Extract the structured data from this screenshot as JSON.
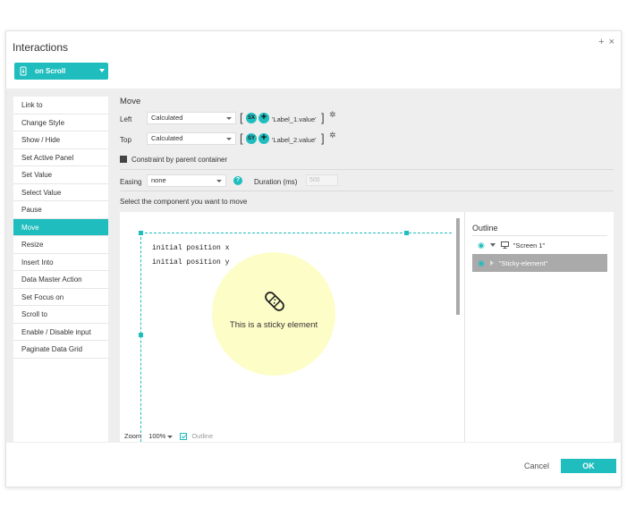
{
  "dialog": {
    "title": "Interactions",
    "add_label": "+",
    "close_label": "×",
    "trigger": {
      "label": "on Scroll",
      "icon": "scroll-icon"
    }
  },
  "actions": [
    "Link to",
    "Change Style",
    "Show / Hide",
    "Set Active Panel",
    "Set Value",
    "Select Value",
    "Pause",
    "Move",
    "Resize",
    "Insert Into",
    "Data Master Action",
    "Set Focus on",
    "Scroll to",
    "Enable / Disable input",
    "Paginate Data Grid"
  ],
  "active_action": "Move",
  "move": {
    "title": "Move",
    "left": {
      "label": "Left",
      "value": "Calculated",
      "fn": "SX",
      "formula": "'Label_1.value'"
    },
    "top": {
      "label": "Top",
      "value": "Calculated",
      "fn": "SY",
      "formula": "'Label_2.value'"
    },
    "bracket_open": "[",
    "bracket_close": "]",
    "constraint_label": "Constraint by parent container",
    "easing_label": "Easing",
    "easing_value": "none",
    "help_label": "?",
    "duration_label": "Duration (ms)",
    "duration_placeholder": "500",
    "select_component_label": "Select the component you want to move"
  },
  "canvas": {
    "code_line_1": "initial position x",
    "code_line_2": "initial position y",
    "sticky_text": "This is a sticky element",
    "zoom_label": "Zoom",
    "zoom_value": "100%",
    "outline_toggle_label": "Outline"
  },
  "outline": {
    "title": "Outline",
    "items": [
      {
        "label": "\"Screen 1\""
      },
      {
        "label": "\"Sticky-element\""
      }
    ]
  },
  "footer": {
    "cancel": "Cancel",
    "ok": "OK"
  },
  "colors": {
    "accent": "#1fbdbd",
    "sticky_fill": "#fdfdc8",
    "selected_row": "#aaaaaa"
  }
}
